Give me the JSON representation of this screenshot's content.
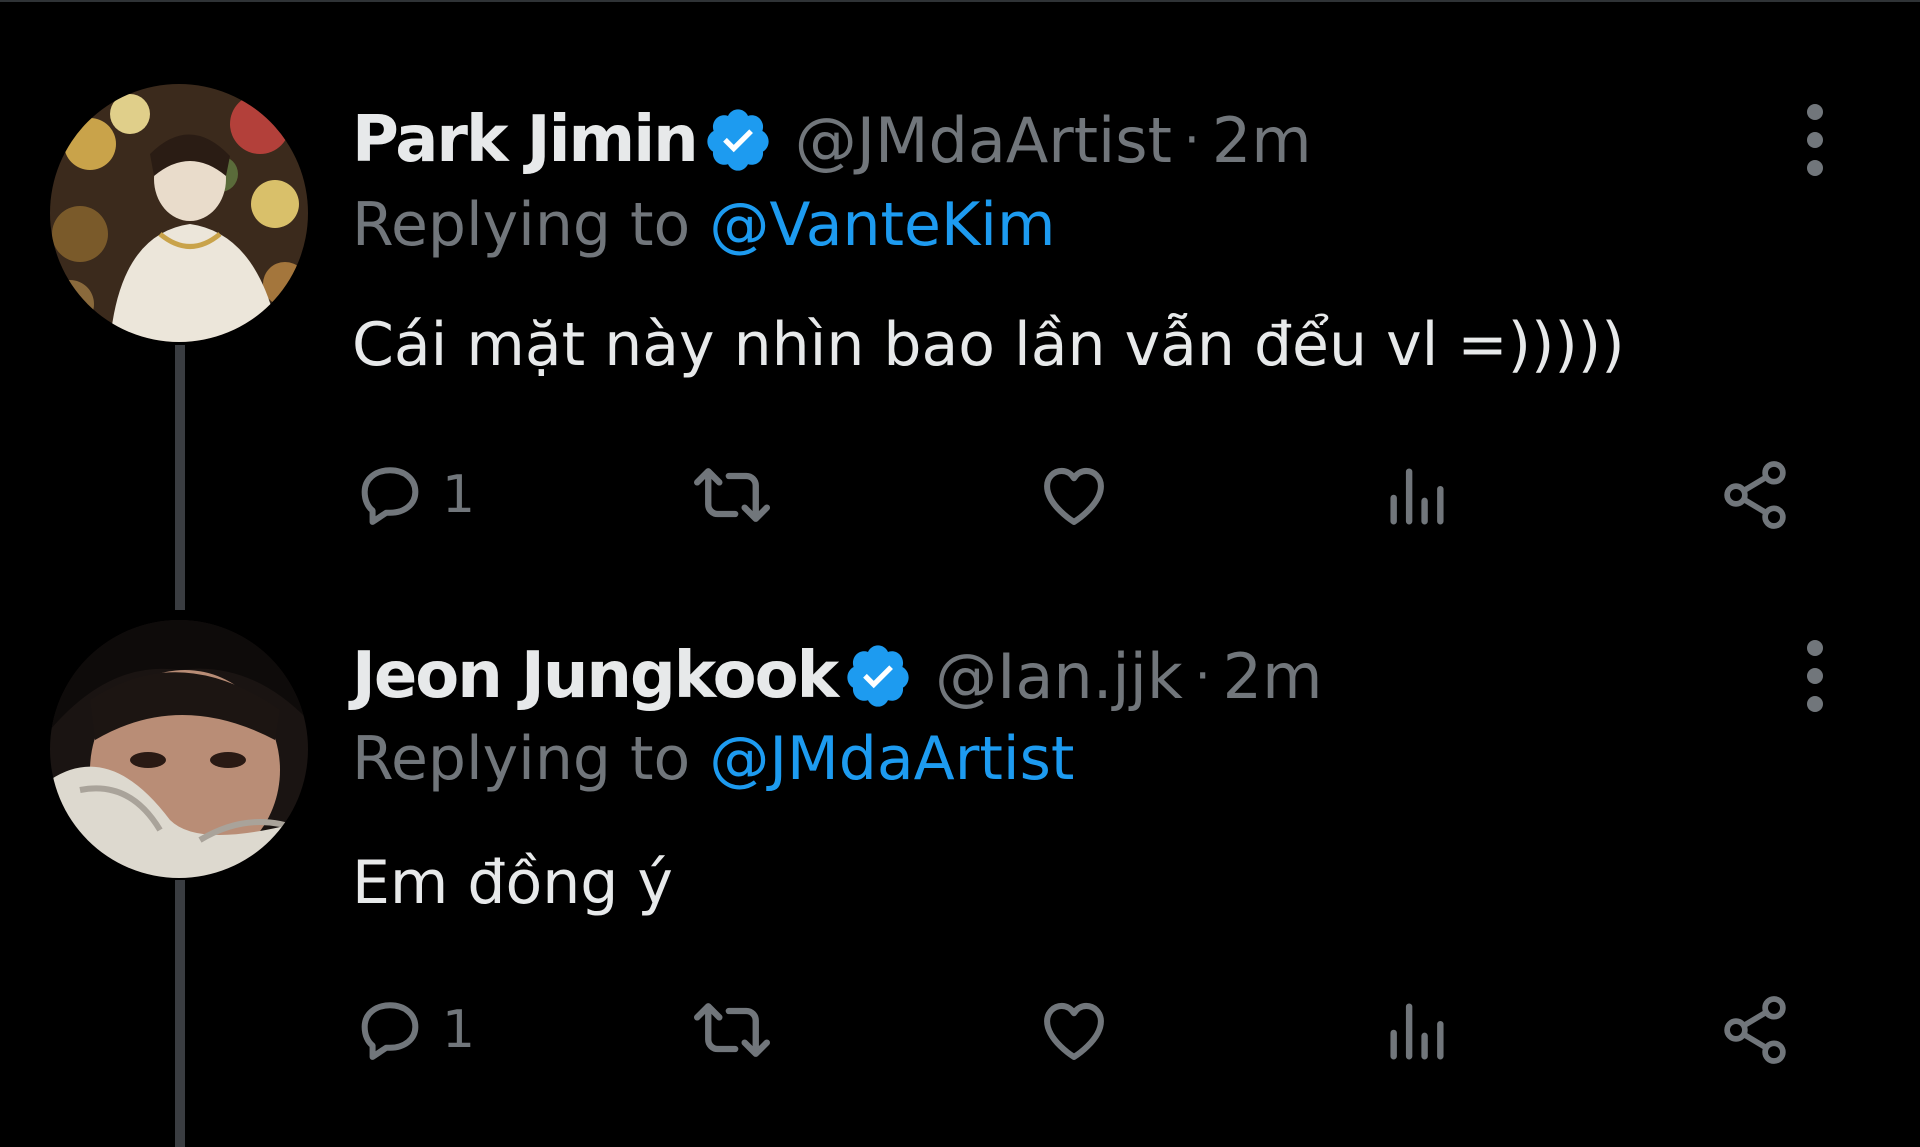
{
  "colors": {
    "background": "#000000",
    "primary_text": "#e7e9ea",
    "secondary_text": "#71767b",
    "accent": "#1d9bf0",
    "thread_line": "#3a3d41"
  },
  "tweets": [
    {
      "display_name": "Park Jimin",
      "verified_icon": "verified-badge-icon",
      "handle": "@JMdaArtist",
      "separator": "·",
      "time": "2m",
      "reply_prefix": "Replying to ",
      "reply_to": "@VanteKim",
      "text": "Cái mặt này nhìn bao lần vẫn đểu vl =)))))",
      "reply_count": "1",
      "icons": [
        "reply-icon",
        "retweet-icon",
        "like-icon",
        "analytics-icon",
        "share-icon",
        "more-options-icon"
      ]
    },
    {
      "display_name": "Jeon Jungkook",
      "verified_icon": "verified-badge-icon",
      "handle": "@Ian.jjk",
      "separator": "·",
      "time": "2m",
      "reply_prefix": "Replying to ",
      "reply_to": "@JMdaArtist",
      "text": "Em đồng ý",
      "reply_count": "1",
      "icons": [
        "reply-icon",
        "retweet-icon",
        "like-icon",
        "analytics-icon",
        "share-icon",
        "more-options-icon"
      ]
    }
  ]
}
